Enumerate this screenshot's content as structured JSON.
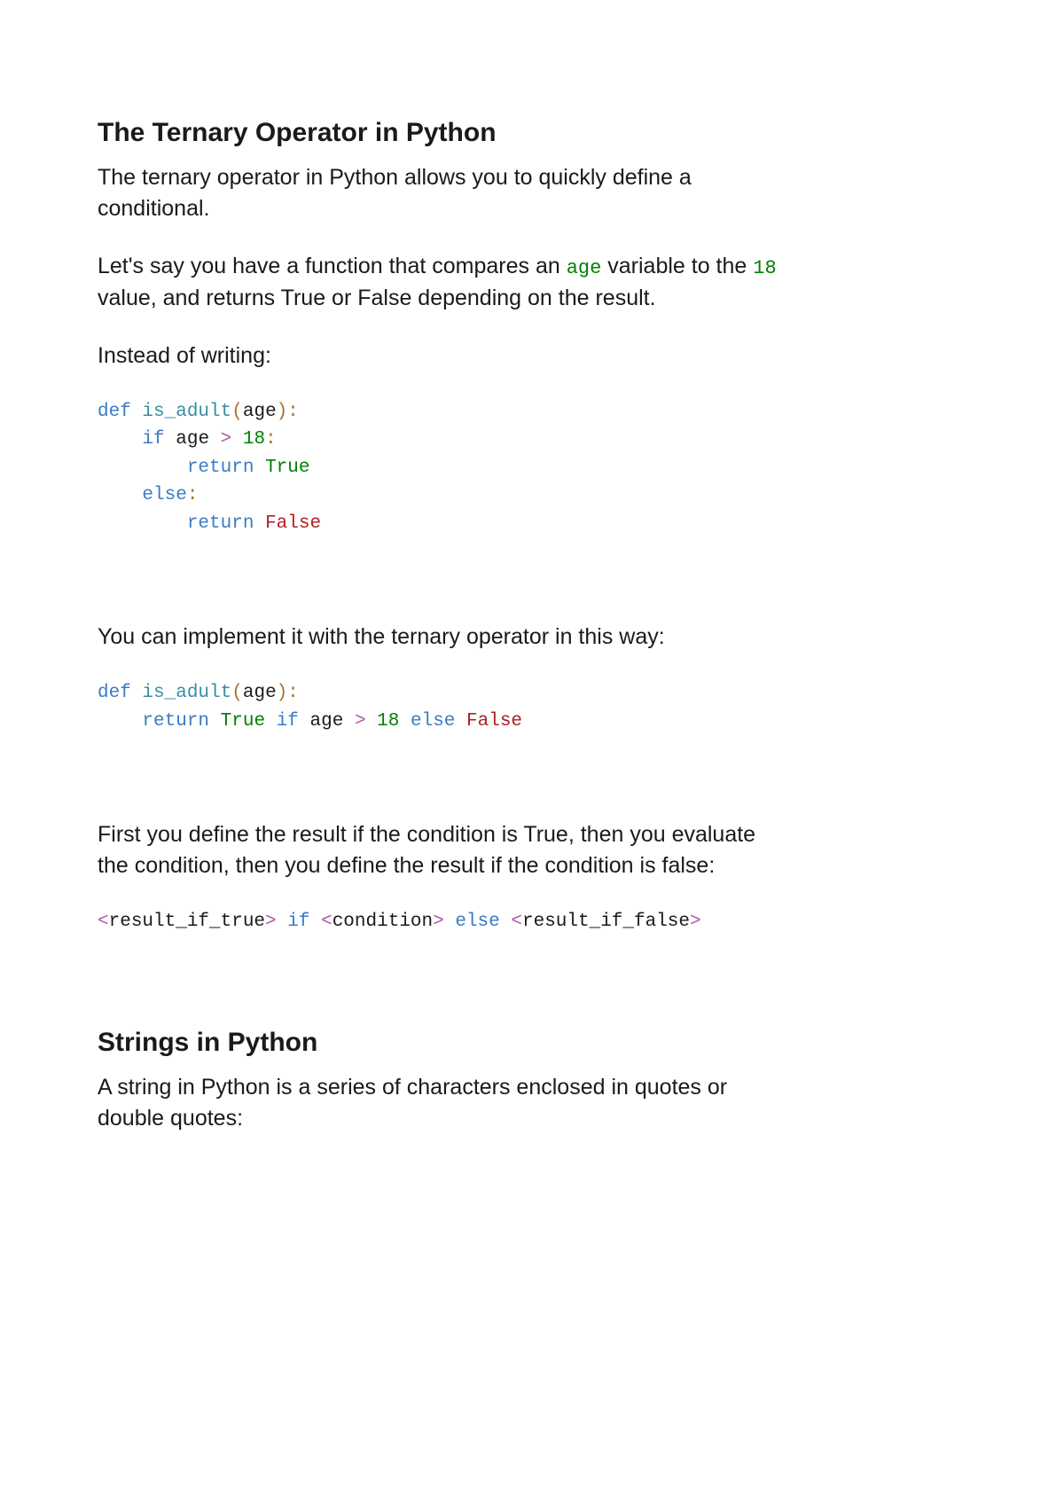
{
  "section1": {
    "heading": "The Ternary Operator in Python",
    "p1": "The ternary operator in Python allows you to quickly define a conditional.",
    "p2_a": "Let's say you have a function that compares an ",
    "p2_code1": "age",
    "p2_b": " variable to the ",
    "p2_code2": "18",
    "p2_c": " value, and returns True or False depending on the result.",
    "p3": "Instead of writing:",
    "p4": "You can implement it with the ternary operator in this way:",
    "p5": "First you define the result if the condition is True, then you evaluate the condition, then you define the result if the condition is false:"
  },
  "code1": {
    "t_def": "def",
    "t_fn": "is_adult",
    "t_lp": "(",
    "t_arg": "age",
    "t_rp": ")",
    "t_colon": ":",
    "t_if": "if",
    "t_age": "age",
    "t_gt": ">",
    "t_18": "18",
    "t_return": "return",
    "t_true": "True",
    "t_else": "else",
    "t_false": "False"
  },
  "code2": {
    "t_def": "def",
    "t_fn": "is_adult",
    "t_lp": "(",
    "t_arg": "age",
    "t_rp": ")",
    "t_colon": ":",
    "t_return": "return",
    "t_true": "True",
    "t_if": "if",
    "t_age": "age",
    "t_gt": ">",
    "t_18": "18",
    "t_else": "else",
    "t_false": "False"
  },
  "code3": {
    "lt1": "<",
    "rit": "result_if_true",
    "gt1": ">",
    "if": "if",
    "lt2": "<",
    "cond": "condition",
    "gt2": ">",
    "else": "else",
    "lt3": "<",
    "rif": "result_if_false",
    "gt3": ">"
  },
  "section2": {
    "heading": "Strings in Python",
    "p1": "A string in Python is a series of characters enclosed in quotes or double quotes:"
  }
}
